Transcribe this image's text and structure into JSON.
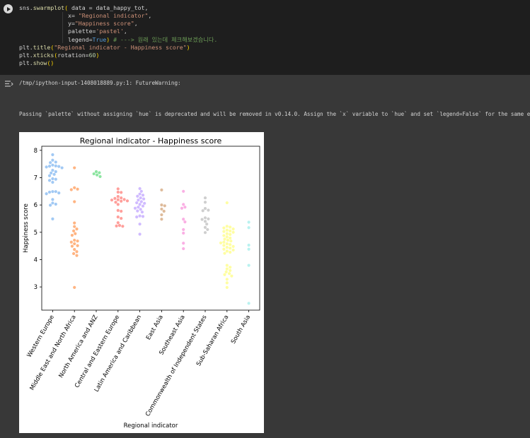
{
  "code": {
    "lines": [
      [
        {
          "t": "sns.",
          "c": "id"
        },
        {
          "t": "swarmplot",
          "c": "fn"
        },
        {
          "t": "( ",
          "c": "par"
        },
        {
          "t": "data = data_happy_tot,",
          "c": "id"
        }
      ],
      [
        {
          "t": "              ",
          "c": "id"
        },
        {
          "t": "x= ",
          "c": "id"
        },
        {
          "t": "\"Regional indicator\"",
          "c": "str"
        },
        {
          "t": ",",
          "c": "id"
        }
      ],
      [
        {
          "t": "              ",
          "c": "id"
        },
        {
          "t": "y=",
          "c": "id"
        },
        {
          "t": "\"Happiness score\"",
          "c": "str"
        },
        {
          "t": ",",
          "c": "id"
        }
      ],
      [
        {
          "t": "              ",
          "c": "id"
        },
        {
          "t": "palette=",
          "c": "id"
        },
        {
          "t": "'pastel'",
          "c": "str"
        },
        {
          "t": ",",
          "c": "id"
        }
      ],
      [
        {
          "t": "              ",
          "c": "id"
        },
        {
          "t": "legend=",
          "c": "id"
        },
        {
          "t": "True",
          "c": "kw"
        },
        {
          "t": ") ",
          "c": "par"
        },
        {
          "t": "# ---> 원래 있는데 체크해보겠습니다.",
          "c": "cm"
        }
      ],
      [
        {
          "t": "plt.",
          "c": "id"
        },
        {
          "t": "title",
          "c": "fn"
        },
        {
          "t": "(",
          "c": "par"
        },
        {
          "t": "\"Regional indicator - Happiness score\"",
          "c": "str"
        },
        {
          "t": ")",
          "c": "par"
        }
      ],
      [
        {
          "t": "plt.",
          "c": "id"
        },
        {
          "t": "xticks",
          "c": "fn"
        },
        {
          "t": "(",
          "c": "par"
        },
        {
          "t": "rotation=",
          "c": "id"
        },
        {
          "t": "60",
          "c": "num"
        },
        {
          "t": ")",
          "c": "par"
        }
      ],
      [
        {
          "t": "plt.",
          "c": "id"
        },
        {
          "t": "show",
          "c": "fn"
        },
        {
          "t": "()",
          "c": "par"
        }
      ]
    ]
  },
  "output": {
    "warning_header": "/tmp/ipython-input-1408018889.py:1: FutureWarning:",
    "warning_body": "Passing `palette` without assigning `hue` is deprecated and will be removed in v0.14.0. Assign the `x` variable to `hue` and set `legend=False` for the same effect."
  },
  "chart_data": {
    "type": "scatter",
    "subtype": "swarm",
    "title": "Regional indicator - Happiness score",
    "xlabel": "Regional indicator",
    "ylabel": "Happiness score",
    "ylim": [
      2.15,
      8.15
    ],
    "yticks": [
      3,
      4,
      5,
      6,
      7,
      8
    ],
    "xtick_rotation": 60,
    "grid": false,
    "categories": [
      "Western Europe",
      "Middle East and North Africa",
      "North America and ANZ",
      "Central and Eastern Europe",
      "Latin America and Caribbean",
      "East Asia",
      "Southeast Asia",
      "Commonwealth of Independent States",
      "Sub-Saharan Africa",
      "South Asia"
    ],
    "colors": [
      "#a1c9f4",
      "#ffb482",
      "#8de5a1",
      "#ff9f9b",
      "#d0bbff",
      "#debb9b",
      "#fab0e4",
      "#cfcfcf",
      "#fffea3",
      "#b9f2f0"
    ],
    "series": [
      {
        "values": [
          7.84,
          7.64,
          7.57,
          7.55,
          7.46,
          7.43,
          7.42,
          7.41,
          7.39,
          7.36,
          7.27,
          7.22,
          7.17,
          7.12,
          7.07,
          6.96,
          6.94,
          6.9,
          6.83,
          6.49,
          6.49,
          6.47,
          6.44,
          6.41,
          6.2,
          6.07,
          6.03,
          5.99,
          5.49
        ]
      },
      {
        "values": [
          7.36,
          6.63,
          6.58,
          6.56,
          6.12,
          5.34,
          5.21,
          5.12,
          5.05,
          4.95,
          4.89,
          4.71,
          4.68,
          4.64,
          4.58,
          4.51,
          4.49,
          4.37,
          4.29,
          4.22,
          4.15,
          2.98
        ]
      },
      {
        "values": [
          7.22,
          7.18,
          7.14,
          7.1,
          7.04
        ]
      },
      {
        "values": [
          6.59,
          6.47,
          6.46,
          6.31,
          6.26,
          6.24,
          6.2,
          6.19,
          6.18,
          6.15,
          6.14,
          6.1,
          6.02,
          5.8,
          5.77,
          5.56,
          5.51,
          5.35,
          5.25,
          5.23,
          5.22
        ]
      },
      {
        "values": [
          6.6,
          6.5,
          6.4,
          6.36,
          6.32,
          6.26,
          6.22,
          6.18,
          6.12,
          6.08,
          6.06,
          6.02,
          5.96,
          5.92,
          5.88,
          5.84,
          5.78,
          5.74,
          5.6,
          5.58,
          5.56,
          5.3,
          4.93
        ]
      },
      {
        "values": [
          6.55,
          6.0,
          5.97,
          5.85,
          5.77,
          5.64,
          5.48
        ]
      },
      {
        "values": [
          6.5,
          6.02,
          5.92,
          5.88,
          5.48,
          5.38,
          5.1,
          4.97,
          4.6,
          4.4
        ]
      },
      {
        "values": [
          6.26,
          6.1,
          5.87,
          5.81,
          5.79,
          5.53,
          5.49,
          5.47,
          5.4,
          5.3,
          5.18,
          5.1,
          4.99
        ]
      },
      {
        "values": [
          6.08,
          5.22,
          5.19,
          5.16,
          5.12,
          5.08,
          5.05,
          5.03,
          5.0,
          4.95,
          4.92,
          4.88,
          4.83,
          4.79,
          4.75,
          4.71,
          4.68,
          4.64,
          4.61,
          4.58,
          4.55,
          4.52,
          4.48,
          4.45,
          4.42,
          4.38,
          4.35,
          4.31,
          4.27,
          4.23,
          3.79,
          3.72,
          3.66,
          3.6,
          3.55,
          3.49,
          3.45,
          3.4,
          3.28,
          3.15,
          2.98
        ]
      },
      {
        "values": [
          5.37,
          5.17,
          4.53,
          4.38,
          3.79,
          2.4
        ]
      }
    ]
  }
}
